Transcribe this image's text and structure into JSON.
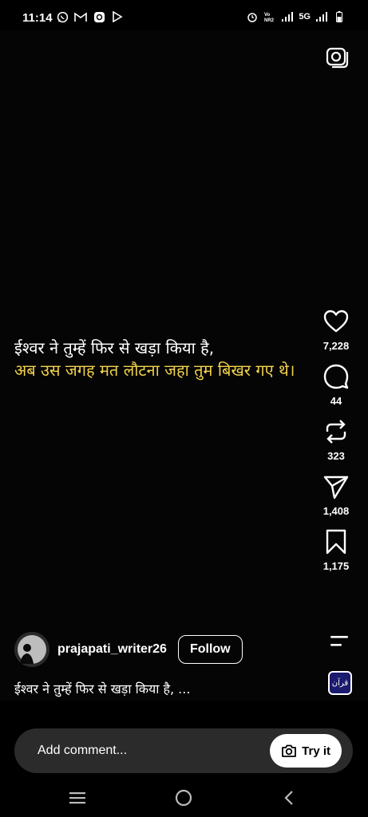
{
  "status_bar": {
    "time": "11:14",
    "network": "5G",
    "left_icons": [
      "whatsapp-icon",
      "gmail-icon",
      "app-icon",
      "play-icon"
    ],
    "right_icons": [
      "alarm-icon",
      "volte-icon",
      "signal-icon",
      "signal-icon",
      "battery-icon"
    ]
  },
  "quote": {
    "line1": "ईश्वर ने तुम्हें फिर से खड़ा किया है,",
    "line2": "अब उस जगह मत लौटना जहा तुम बिखर गए थे।",
    "line1_color": "#ffffff",
    "line2_color": "#f2d24a"
  },
  "actions": {
    "likes": "7,228",
    "comments": "44",
    "reposts": "323",
    "shares": "1,408",
    "saves": "1,175"
  },
  "post": {
    "username": "prajapati_writer26",
    "follow_label": "Follow",
    "caption": "ईश्वर ने तुम्हें फिर से खड़ा किया है, ...",
    "audio_thumb_text": "قرآن"
  },
  "comment": {
    "placeholder": "Add comment...",
    "try_label": "Try it"
  }
}
